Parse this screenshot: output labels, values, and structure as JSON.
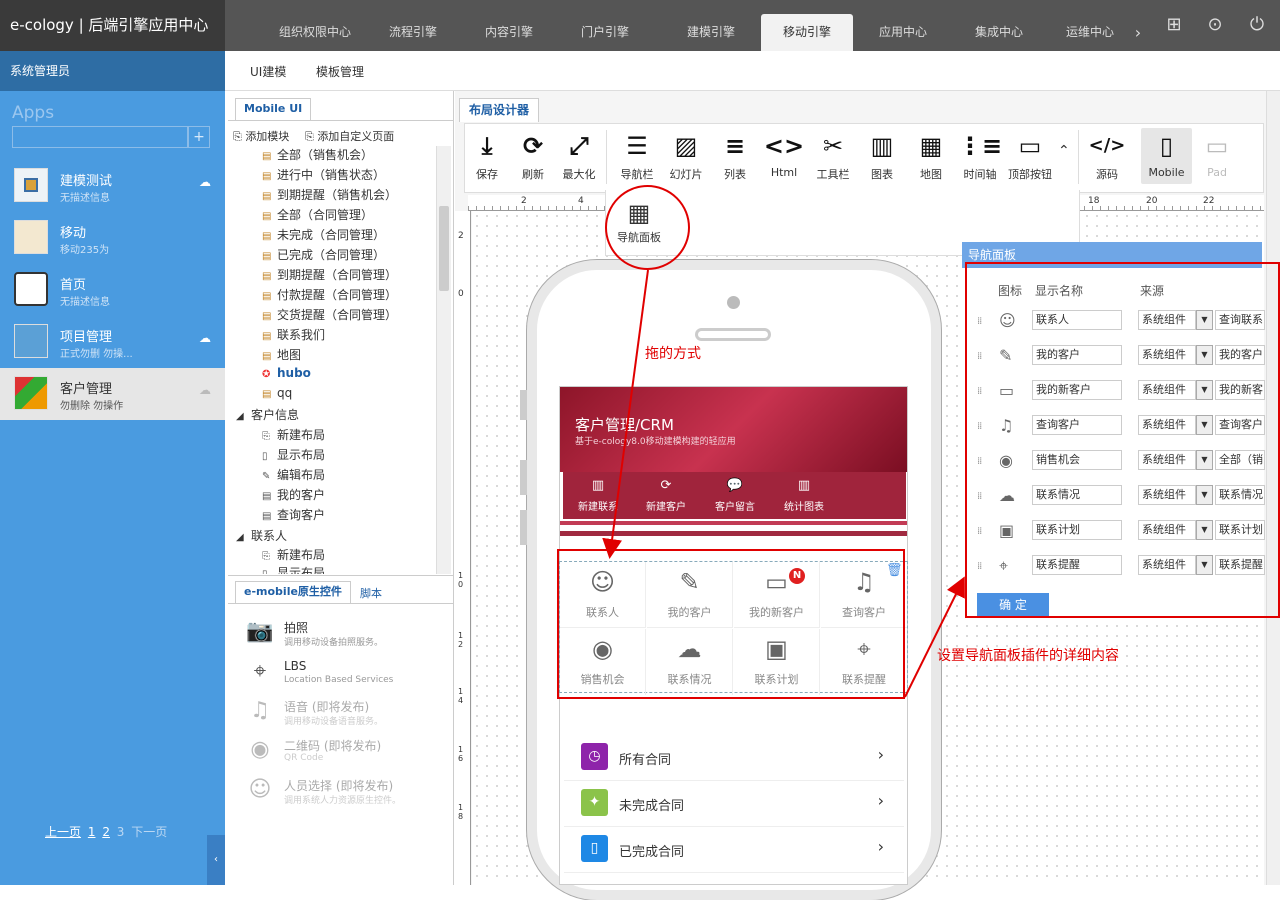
{
  "brand": "e-cology | 后端引擎应用中心",
  "top_nav": [
    "组织权限中心",
    "流程引擎",
    "内容引擎",
    "门户引擎",
    "建模引擎",
    "移动引擎",
    "应用中心",
    "集成中心",
    "运维中心"
  ],
  "top_nav_more": "›",
  "admin_label": "系统管理员",
  "apps": {
    "title": "Apps",
    "search_placeholder": "",
    "add": "+",
    "items": [
      {
        "name": "建模测试",
        "sub": "无描述信息"
      },
      {
        "name": "移动",
        "sub": "移动235为"
      },
      {
        "name": "首页",
        "sub": "无描述信息"
      },
      {
        "name": "项目管理",
        "sub": "正式勿删 勿操..."
      },
      {
        "name": "客户管理",
        "sub": "勿删除 勿操作"
      }
    ],
    "pager": {
      "prev": "上一页",
      "p1": "1",
      "p2": "2",
      "p3": "3",
      "next": "下一页"
    }
  },
  "sub_nav": [
    "UI建模",
    "模板管理"
  ],
  "tree_panel": {
    "tab": "Mobile UI",
    "add_module": "添加模块",
    "add_custom_page": "添加自定义页面",
    "rows": [
      "全部（销售机会）",
      "进行中（销售状态）",
      "到期提醒（销售机会）",
      "全部（合同管理）",
      "未完成（合同管理）",
      "已完成（合同管理）",
      "到期提醒（合同管理）",
      "付款提醒（合同管理）",
      "交货提醒（合同管理）",
      "联系我们",
      "地图",
      "hubo",
      "qq",
      "客户信息",
      "新建布局",
      "显示布局",
      "编辑布局",
      "我的客户",
      "查询客户",
      "联系人",
      "新建布局",
      "显示布局"
    ]
  },
  "controls_panel": {
    "tab_active": "e-mobile原生控件",
    "tab_other": "脚本",
    "items": [
      {
        "name": "拍照",
        "desc": "调用移动设备拍照服务。"
      },
      {
        "name": "LBS",
        "desc": "Location Based Services"
      },
      {
        "name": "语音 (即将发布)",
        "desc": "调用移动设备语音服务。"
      },
      {
        "name": "二维码 (即将发布)",
        "desc": "QR Code"
      },
      {
        "name": "人员选择 (即将发布)",
        "desc": "调用系统人力资源原生控件。"
      }
    ]
  },
  "designer": {
    "tab": "布局设计器",
    "toolbar": [
      "保存",
      "刷新",
      "最大化",
      "导航栏",
      "幻灯片",
      "列表",
      "Html",
      "工具栏",
      "图表",
      "地图",
      "时间轴",
      "顶部按钮",
      "源码",
      "Mobile",
      "Pad"
    ],
    "dropdown_item": "导航面板",
    "ruler_marks": [
      "2",
      "4",
      "18",
      "20",
      "22"
    ],
    "vruler_marks": [
      "2",
      "0",
      "1 0",
      "1 2",
      "1 4",
      "1 6",
      "1 8"
    ]
  },
  "phone": {
    "header_title": "客户管理/CRM",
    "header_sub": "基于e-cology8.0移动建模构建的轻应用",
    "buttons": [
      "新建联系",
      "新建客户",
      "客户留言",
      "统计图表"
    ],
    "nav_items": [
      "联系人",
      "我的客户",
      "我的新客户",
      "查询客户",
      "销售机会",
      "联系情况",
      "联系计划",
      "联系提醒"
    ],
    "badge": "N",
    "list": [
      "所有合同",
      "未完成合同",
      "已完成合同"
    ]
  },
  "annotations": {
    "drag": "拖的方式",
    "settings": "设置导航面板插件的详细内容"
  },
  "settings": {
    "header": "导航面板",
    "col_icon": "图标",
    "col_name": "显示名称",
    "col_source": "来源",
    "rows": [
      {
        "name": "联系人",
        "source": "系统组件",
        "target": "查询联系"
      },
      {
        "name": "我的客户",
        "source": "系统组件",
        "target": "我的客户"
      },
      {
        "name": "我的新客户",
        "source": "系统组件",
        "target": "我的新客"
      },
      {
        "name": "查询客户",
        "source": "系统组件",
        "target": "查询客户"
      },
      {
        "name": "销售机会",
        "source": "系统组件",
        "target": "全部（销"
      },
      {
        "name": "联系情况",
        "source": "系统组件",
        "target": "联系情况"
      },
      {
        "name": "联系计划",
        "source": "系统组件",
        "target": "联系计划"
      },
      {
        "name": "联系提醒",
        "source": "系统组件",
        "target": "联系提醒"
      }
    ],
    "ok": "确 定"
  },
  "colors": {
    "accent": "#4a9be0",
    "crm": "#a0243c",
    "annotation": "#e00000"
  }
}
